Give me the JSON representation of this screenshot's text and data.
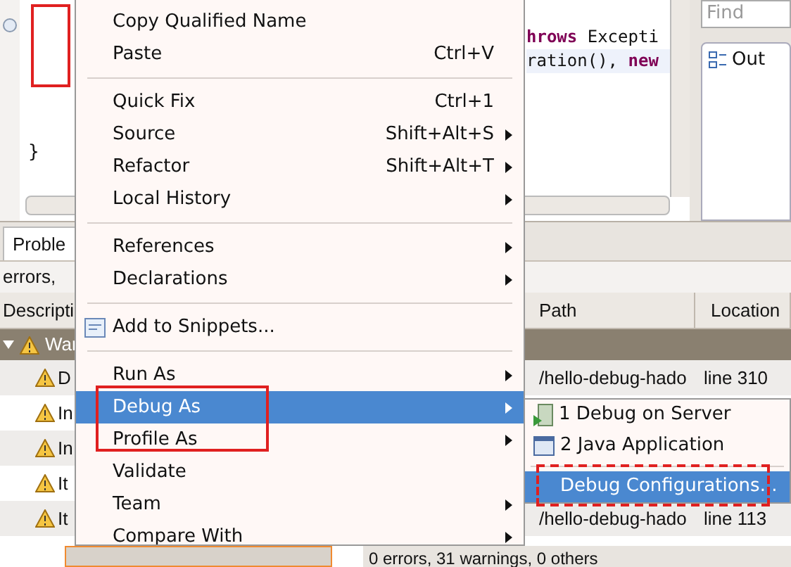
{
  "editor": {
    "lines": [
      {
        "text": "**hrows** Excepti",
        "current": false
      },
      {
        "text": "ration(), **new**",
        "current": true
      }
    ],
    "closing_brace": "}"
  },
  "find_field": {
    "placeholder": "Find"
  },
  "outline": {
    "title": "Out"
  },
  "problems": {
    "tab": "Proble",
    "summary": "errors,",
    "columns": [
      "Descripti",
      "Path",
      "Location"
    ],
    "group": "War",
    "rows": [
      {
        "description": "D",
        "path": "/hello-debug-hado",
        "location": "line 310"
      },
      {
        "description": "In"
      },
      {
        "description": "In"
      },
      {
        "description": "It"
      },
      {
        "description": "It",
        "path": "/hello-debug-hado",
        "location": "line 113"
      }
    ]
  },
  "status": "0 errors, 31 warnings, 0 others",
  "context_menu": [
    {
      "kind": "item",
      "label": "Copy Qualified Name",
      "submenu": false,
      "selected": false
    },
    {
      "kind": "item",
      "label": "Paste",
      "shortcut": "Ctrl+V",
      "submenu": false,
      "selected": false
    },
    {
      "kind": "separator"
    },
    {
      "kind": "item",
      "label": "Quick Fix",
      "shortcut": "Ctrl+1",
      "submenu": false,
      "selected": false
    },
    {
      "kind": "item",
      "label": "Source",
      "shortcut": "Shift+Alt+S",
      "submenu": true,
      "selected": false
    },
    {
      "kind": "item",
      "label": "Refactor",
      "shortcut": "Shift+Alt+T",
      "submenu": true,
      "selected": false
    },
    {
      "kind": "item",
      "label": "Local History",
      "submenu": true,
      "selected": false
    },
    {
      "kind": "separator"
    },
    {
      "kind": "item",
      "label": "References",
      "submenu": true,
      "selected": false
    },
    {
      "kind": "item",
      "label": "Declarations",
      "submenu": true,
      "selected": false
    },
    {
      "kind": "separator"
    },
    {
      "kind": "icon_item",
      "label": "Add to Snippets...",
      "submenu": false,
      "selected": false
    },
    {
      "kind": "separator"
    },
    {
      "kind": "item",
      "label": "Run As",
      "submenu": true,
      "selected": false
    },
    {
      "kind": "item",
      "label": "Debug As",
      "submenu": true,
      "selected": true
    },
    {
      "kind": "item",
      "label": "Profile As",
      "submenu": true,
      "selected": false
    },
    {
      "kind": "item",
      "label": "Validate",
      "submenu": false,
      "selected": false
    },
    {
      "kind": "item",
      "label": "Team",
      "submenu": true,
      "selected": false
    },
    {
      "kind": "item",
      "label": "Compare With",
      "submenu": true,
      "selected": false
    }
  ],
  "submenu": [
    {
      "kind": "server",
      "label": "1 Debug on Server",
      "selected": false
    },
    {
      "kind": "java",
      "label": "2 Java Application",
      "selected": false
    },
    {
      "kind": "separator"
    },
    {
      "kind": "plain",
      "label": "Debug Configurations...",
      "selected": true
    }
  ]
}
